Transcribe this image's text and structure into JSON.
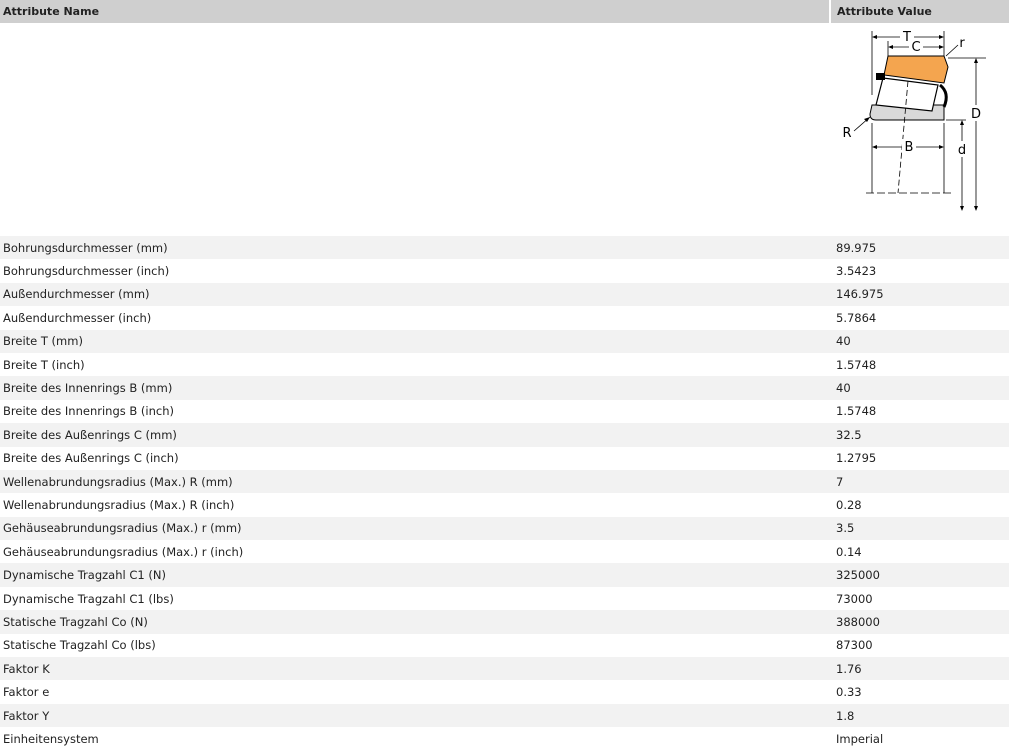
{
  "header": {
    "attribute_name": "Attribute Name",
    "attribute_value": "Attribute Value"
  },
  "diagram": {
    "labels": {
      "T": "T",
      "C": "C",
      "r": "r",
      "D": "D",
      "R": "R",
      "B": "B",
      "d": "d"
    },
    "colors": {
      "cup": "#f4a54f",
      "cone": "#d9d9d9",
      "line": "#000000"
    }
  },
  "rows": [
    {
      "name": "Bohrungsdurchmesser (mm)",
      "value": "89.975"
    },
    {
      "name": "Bohrungsdurchmesser (inch)",
      "value": "3.5423"
    },
    {
      "name": "Außendurchmesser (mm)",
      "value": "146.975"
    },
    {
      "name": "Außendurchmesser (inch)",
      "value": "5.7864"
    },
    {
      "name": "Breite T (mm)",
      "value": "40"
    },
    {
      "name": "Breite T (inch)",
      "value": "1.5748"
    },
    {
      "name": "Breite des Innenrings B (mm)",
      "value": "40"
    },
    {
      "name": "Breite des Innenrings B (inch)",
      "value": "1.5748"
    },
    {
      "name": "Breite des Außenrings C (mm)",
      "value": "32.5"
    },
    {
      "name": "Breite des Außenrings C (inch)",
      "value": "1.2795"
    },
    {
      "name": "Wellenabrundungsradius (Max.) R (mm)",
      "value": "7"
    },
    {
      "name": "Wellenabrundungsradius (Max.) R (inch)",
      "value": "0.28"
    },
    {
      "name": "Gehäuseabrundungsradius (Max.) r (mm)",
      "value": "3.5"
    },
    {
      "name": "Gehäuseabrundungsradius (Max.) r (inch)",
      "value": "0.14"
    },
    {
      "name": "Dynamische Tragzahl C1 (N)",
      "value": "325000"
    },
    {
      "name": "Dynamische Tragzahl C1 (lbs)",
      "value": "73000"
    },
    {
      "name": "Statische Tragzahl Co (N)",
      "value": "388000"
    },
    {
      "name": "Statische Tragzahl Co (lbs)",
      "value": "87300"
    },
    {
      "name": "Faktor K",
      "value": "1.76"
    },
    {
      "name": "Faktor e",
      "value": "0.33"
    },
    {
      "name": "Faktor Y",
      "value": "1.8"
    },
    {
      "name": "Einheitensystem",
      "value": "Imperial"
    }
  ]
}
